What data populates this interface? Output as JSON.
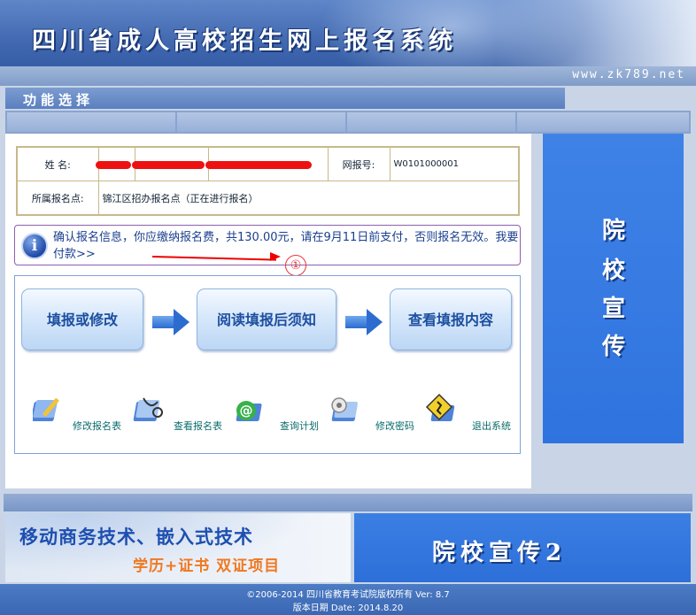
{
  "header": {
    "title": "四川省成人高校招生网上报名系统",
    "url": "www.zk789.net"
  },
  "menu": {
    "title": "功能选择"
  },
  "info": {
    "name_label": "姓  名:",
    "exam_no_label": "网报号:",
    "exam_no": "W0101000001",
    "site_label": "所属报名点:",
    "site_value": "锦江区招办报名点（正在进行报名）"
  },
  "notice": {
    "text": "确认报名信息，你应缴纳报名费，共130.00元，请在9月11日前支付，否则报名无效。",
    "pay_link": "我要付款>>",
    "annotation": "①"
  },
  "steps": [
    {
      "label": "填报或修改"
    },
    {
      "label": "阅读填报后须知"
    },
    {
      "label": "查看填报内容"
    }
  ],
  "quick_links": [
    {
      "label": "修改报名表",
      "icon": "edit-form-icon"
    },
    {
      "label": "查看报名表",
      "icon": "view-form-icon"
    },
    {
      "label": "查询计划",
      "icon": "query-plan-icon"
    },
    {
      "label": "修改密码",
      "icon": "change-password-icon"
    },
    {
      "label": "退出系统",
      "icon": "exit-icon"
    }
  ],
  "promo_right": {
    "chars": [
      "院",
      "校",
      "宣",
      "传"
    ]
  },
  "footer": {
    "ad_line1": "移动商务技术、嵌入式技术",
    "ad_line2": "学历+证书 双证项目",
    "promo_bottom": "院校宣传2",
    "copyright": "©2006-2014 四川省教育考试院版权所有   Ver: 8.7",
    "version_date": "版本日期 Date: 2014.8.20"
  },
  "colors": {
    "header_blue": "#3e65ad",
    "promo_blue": "#2f73df",
    "notice_text": "#1a3f8f",
    "redaction_red": "#ee1111",
    "link_teal": "#0b6b6b"
  }
}
